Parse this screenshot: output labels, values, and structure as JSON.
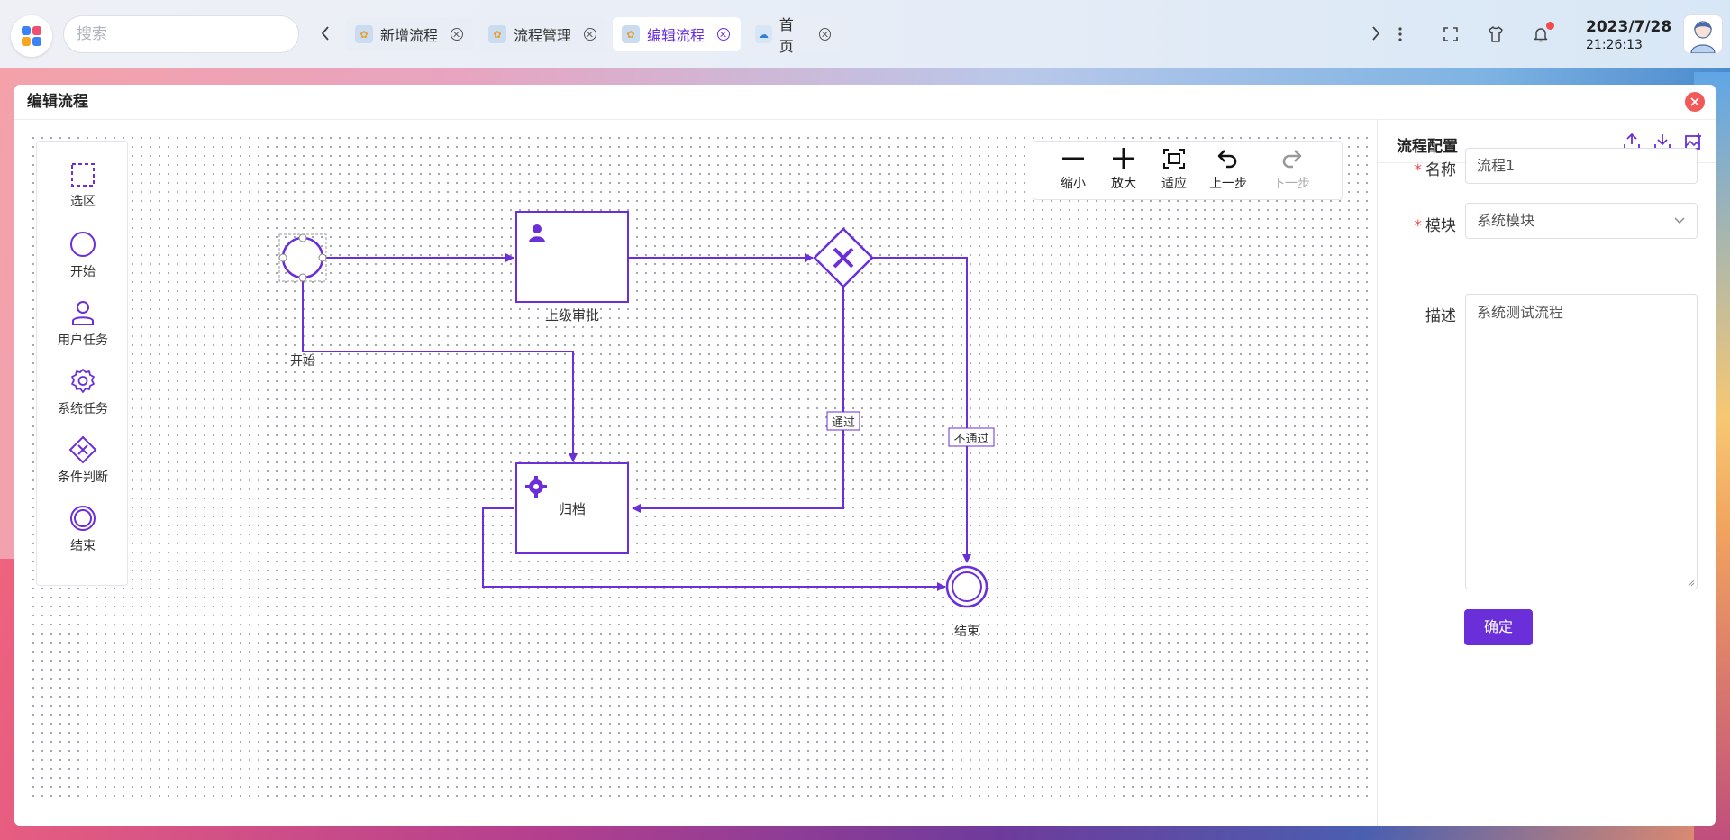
{
  "search": {
    "placeholder": "搜索"
  },
  "tabs": [
    {
      "label": "新增流程",
      "active": false
    },
    {
      "label": "流程管理",
      "active": false
    },
    {
      "label": "编辑流程",
      "active": true
    },
    {
      "label": "首页",
      "active": false
    }
  ],
  "datetime": {
    "date": "2023/7/28",
    "time": "21:26:13"
  },
  "window": {
    "title": "编辑流程"
  },
  "palette": {
    "items": [
      {
        "label": "选区",
        "icon": "lasso-select-icon"
      },
      {
        "label": "开始",
        "icon": "start-event-icon"
      },
      {
        "label": "用户任务",
        "icon": "user-task-icon"
      },
      {
        "label": "系统任务",
        "icon": "service-task-icon"
      },
      {
        "label": "条件判断",
        "icon": "gateway-icon"
      },
      {
        "label": "结束",
        "icon": "end-event-icon"
      }
    ]
  },
  "zoombar": {
    "items": [
      {
        "label": "缩小",
        "icon": "zoom-out-icon",
        "disabled": false
      },
      {
        "label": "放大",
        "icon": "zoom-in-icon",
        "disabled": false
      },
      {
        "label": "适应",
        "icon": "fit-view-icon",
        "disabled": false
      },
      {
        "label": "上一步",
        "icon": "undo-icon",
        "disabled": false
      },
      {
        "label": "下一步",
        "icon": "redo-icon",
        "disabled": true
      }
    ]
  },
  "diagram": {
    "start_label": "开始",
    "approve_task_label": "上级审批",
    "archive_task_label": "归档",
    "end_label": "结束",
    "pass_label": "通过",
    "reject_label": "不通过"
  },
  "panel": {
    "title": "流程配置",
    "name_label": "名称",
    "name_value": "流程1",
    "module_label": "模块",
    "module_value": "系统模块",
    "desc_label": "描述",
    "desc_value": "系统测试流程",
    "confirm_label": "确定"
  },
  "colors": {
    "accent": "#6a2fd8",
    "diagram_stroke": "#6a2fd8",
    "danger": "#f25a5a"
  }
}
